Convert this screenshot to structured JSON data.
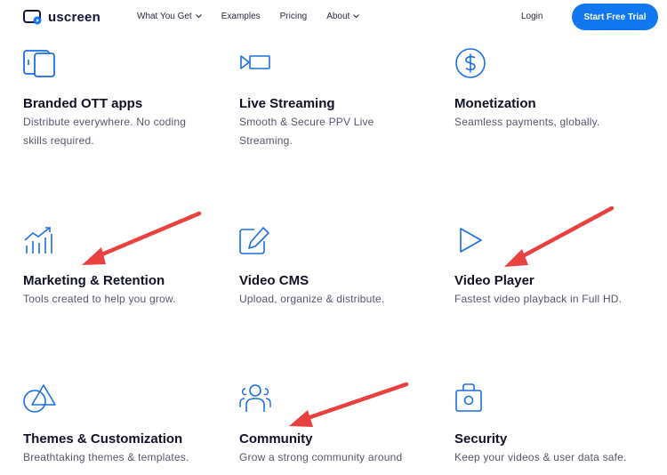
{
  "nav": {
    "logo_text": "uscreen",
    "links": [
      "What You Get",
      "Examples",
      "Pricing",
      "About"
    ],
    "login": "Login",
    "cta": "Start Free Trial"
  },
  "features": [
    {
      "title": "Branded OTT apps",
      "desc": "Distribute everywhere. No coding skills required.",
      "icon": "devices-icon"
    },
    {
      "title": "Live Streaming",
      "desc": "Smooth & Secure PPV Live Streaming.",
      "icon": "live-stream-icon"
    },
    {
      "title": "Monetization",
      "desc": "Seamless payments, globally.",
      "icon": "dollar-icon"
    },
    {
      "title": "Marketing & Retention",
      "desc": "Tools created to help you grow.",
      "icon": "growth-chart-icon"
    },
    {
      "title": "Video CMS",
      "desc": "Upload, organize & distribute.",
      "icon": "edit-icon"
    },
    {
      "title": "Video Player",
      "desc": "Fastest video playback in Full HD.",
      "icon": "play-icon"
    },
    {
      "title": "Themes & Customization",
      "desc": "Breathtaking themes & templates.",
      "icon": "shapes-icon"
    },
    {
      "title": "Community",
      "desc": "Grow a strong community around",
      "icon": "people-icon"
    },
    {
      "title": "Security",
      "desc": "Keep your videos & user data safe.",
      "icon": "lock-icon"
    }
  ],
  "colors": {
    "accent": "#1177ee",
    "icon": "#1a6fe0",
    "annotation_arrow": "#e8413f"
  }
}
